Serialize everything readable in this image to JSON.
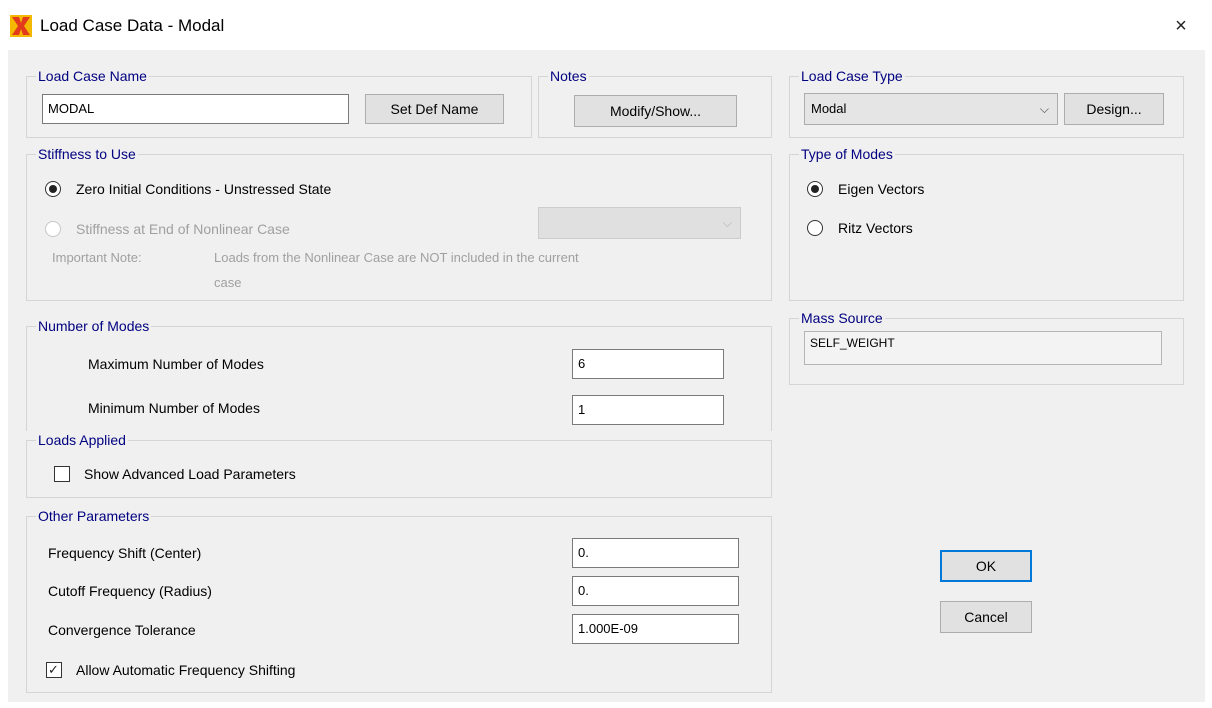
{
  "window": {
    "title": "Load Case Data - Modal",
    "close": "×"
  },
  "load_case_name": {
    "label": "Load Case Name",
    "value": "MODAL",
    "set_def_name": "Set Def Name"
  },
  "notes": {
    "label": "Notes",
    "button": "Modify/Show..."
  },
  "load_case_type": {
    "label": "Load Case Type",
    "value": "Modal",
    "design_button": "Design..."
  },
  "stiffness": {
    "label": "Stiffness to Use",
    "option1": "Zero Initial Conditions - Unstressed State",
    "option2": "Stiffness at End of Nonlinear Case",
    "note_label": "Important Note:",
    "note_line1": "Loads from the Nonlinear Case are NOT included in the current",
    "note_line2": "case"
  },
  "type_of_modes": {
    "label": "Type of Modes",
    "option1": "Eigen Vectors",
    "option2": "Ritz Vectors"
  },
  "mass_source": {
    "label": "Mass Source",
    "value": "SELF_WEIGHT"
  },
  "number_of_modes": {
    "label": "Number of Modes",
    "max_label": "Maximum Number of Modes",
    "max_value": "6",
    "min_label": "Minimum Number of Modes",
    "min_value": "1"
  },
  "loads_applied": {
    "label": "Loads Applied",
    "show_advanced": "Show Advanced Load Parameters"
  },
  "other": {
    "label": "Other Parameters",
    "freq_shift_label": "Frequency Shift (Center)",
    "freq_shift_value": "0.",
    "cutoff_label": "Cutoff Frequency (Radius)",
    "cutoff_value": "0.",
    "tolerance_label": "Convergence Tolerance",
    "tolerance_value": "1.000E-09",
    "auto_shift": "Allow Automatic Frequency Shifting"
  },
  "buttons": {
    "ok": "OK",
    "cancel": "Cancel"
  },
  "icons": {
    "app": "sap-app-icon",
    "close": "close-icon",
    "dropdown": "chevron-down-icon"
  },
  "colors": {
    "group_label": "#000080",
    "accent": "#0078d7",
    "icon_red": "#e23a1a",
    "icon_yellow": "#f5b800"
  }
}
